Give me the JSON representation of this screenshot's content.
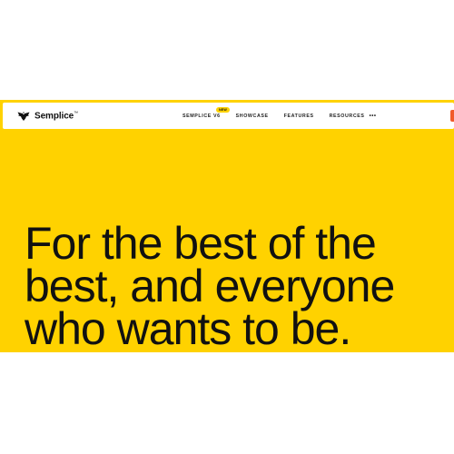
{
  "brand": {
    "name": "Semplice",
    "trademark": "™",
    "logo_icon": "eagle-icon"
  },
  "nav": {
    "items": [
      {
        "label": "SEMPLICE V6",
        "badge": "NEW"
      },
      {
        "label": "SHOWCASE"
      },
      {
        "label": "FEATURES"
      },
      {
        "label": "RESOURCES",
        "more_icon": "•••"
      }
    ]
  },
  "hero": {
    "headline_lines": [
      "For the best of the",
      "best, and everyone",
      "who wants to be."
    ]
  },
  "colors": {
    "accent": "#FFD200",
    "cta": "#F15A2B",
    "text": "#111111"
  }
}
